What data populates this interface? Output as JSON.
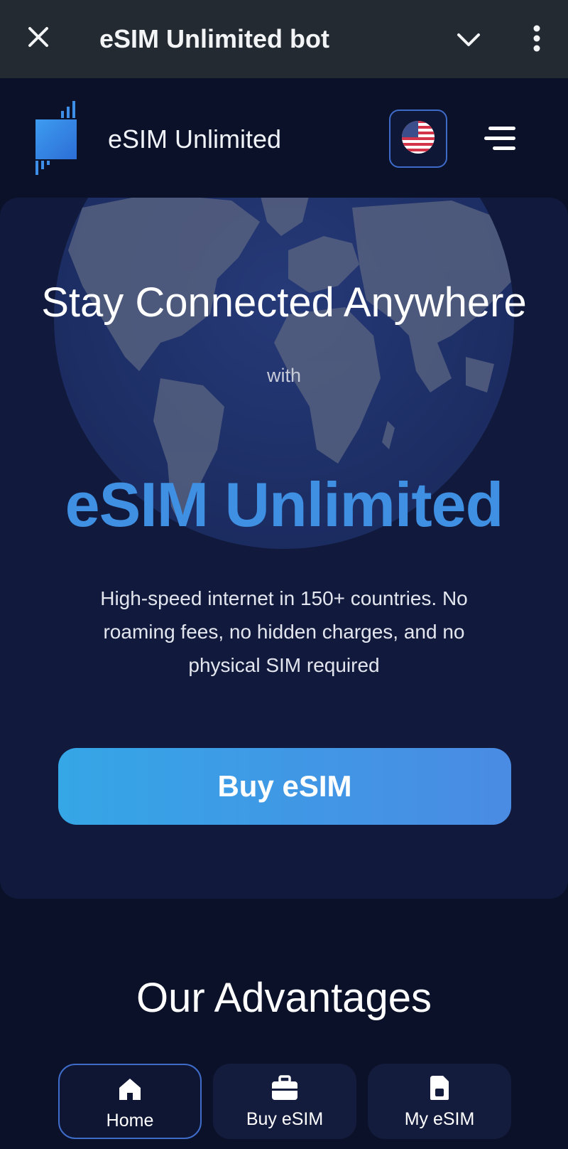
{
  "topbar": {
    "title": "eSIM Unlimited bot",
    "icons": [
      "close-icon",
      "chevron-down-icon",
      "more-vertical-icon"
    ]
  },
  "header": {
    "brand": "eSIM Unlimited",
    "language_icon": "us-flag-icon",
    "menu_icon": "hamburger-menu-icon"
  },
  "hero": {
    "title": "Stay Connected Anywhere",
    "with": "with",
    "brand": "eSIM Unlimited",
    "description": "High-speed internet in 150+ countries. No roaming fees, no hidden charges, and no physical SIM required",
    "cta_label": "Buy eSIM"
  },
  "advantages": {
    "title": "Our Advantages"
  },
  "nav": {
    "items": [
      {
        "label": "Home",
        "icon": "home-icon",
        "active": true
      },
      {
        "label": "Buy eSIM",
        "icon": "briefcase-icon",
        "active": false
      },
      {
        "label": "My eSIM",
        "icon": "sim-card-icon",
        "active": false
      }
    ]
  },
  "colors": {
    "background": "#0b1129",
    "card": "#111a3c",
    "topbar": "#232a31",
    "accent": "#3f8fe3",
    "button_start": "#35a6e6",
    "button_end": "#4a8be4"
  }
}
